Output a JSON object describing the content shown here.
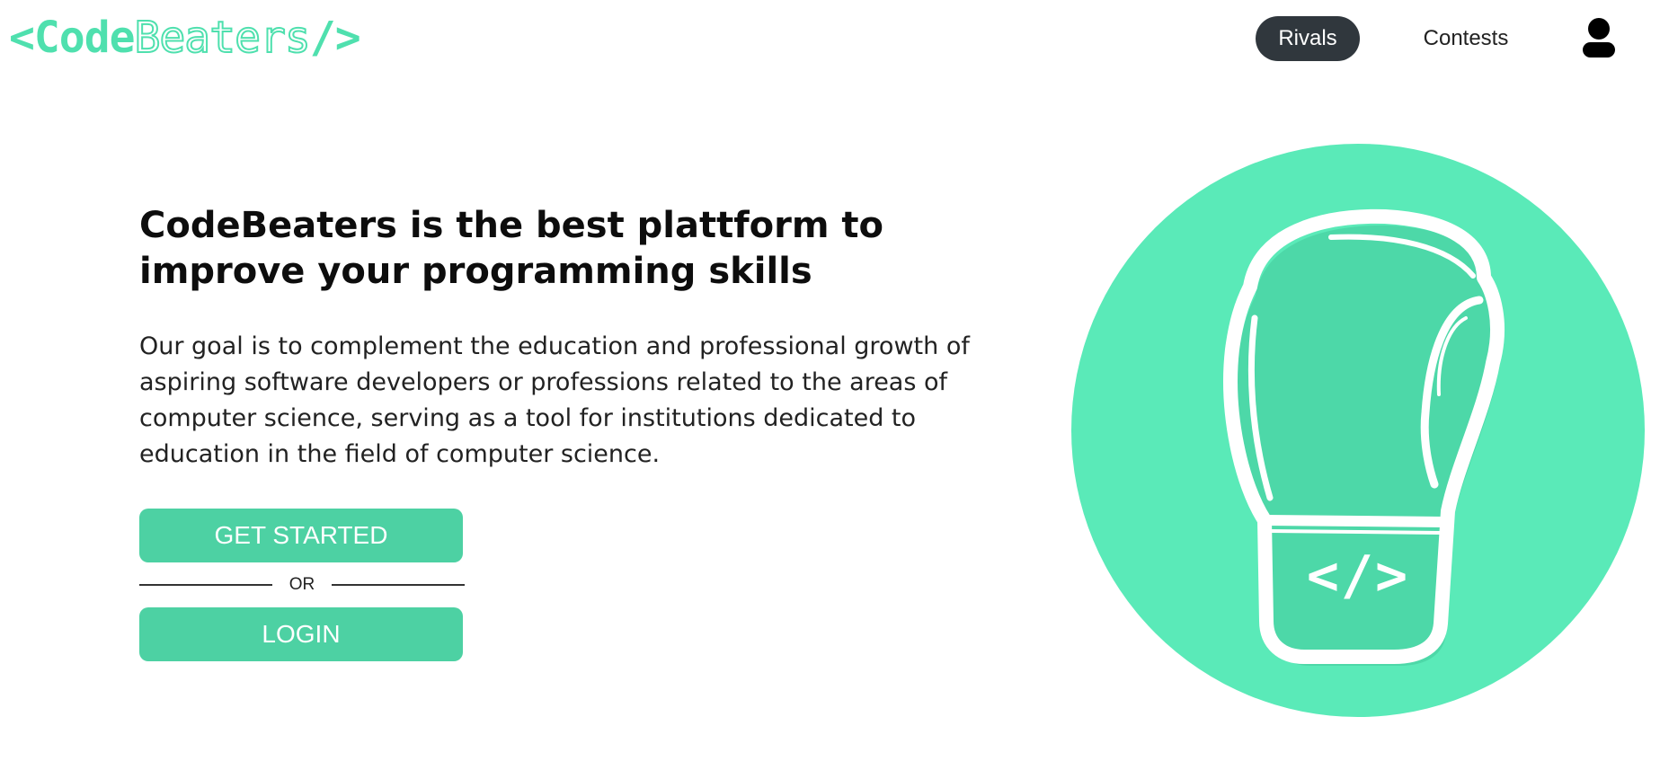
{
  "header": {
    "logo": {
      "bracket_open": "<",
      "code": "Code",
      "beaters": "Beaters",
      "bracket_close": "/>"
    },
    "nav": {
      "rivals": "Rivals",
      "contests": "Contests"
    },
    "user_icon": "user-icon"
  },
  "hero": {
    "title_line1": "CodeBeaters is the best plattform to",
    "title_line2": "improve your programming skills",
    "text_lines": [
      "Our goal is to complement the education and professional growth of",
      "aspiring software developers or professions related to the areas of",
      "computer science, serving as a tool for institutions dedicated to",
      "education in the field of computer science."
    ],
    "get_started": "GET STARTED",
    "or": "OR",
    "login": "LOGIN",
    "illustration": "boxing-glove-icon",
    "glove_code": "</>"
  },
  "colors": {
    "accent": "#4fe0ae",
    "button": "#4dd1a3",
    "nav_active_bg": "#30373d",
    "circle": "#5aeab8"
  }
}
